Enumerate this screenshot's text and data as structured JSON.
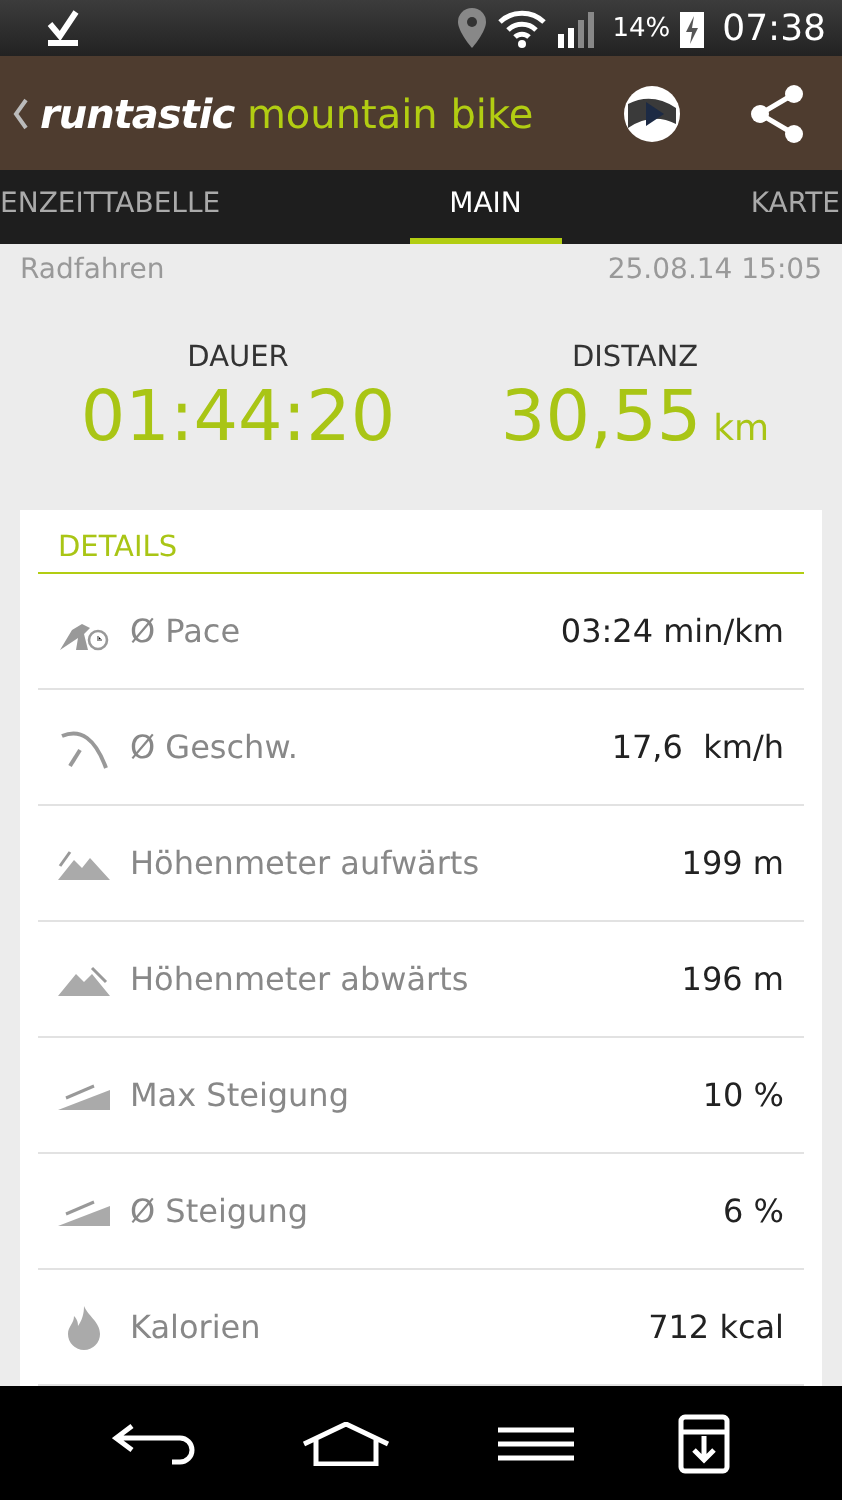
{
  "status_bar": {
    "battery": "14%",
    "time": "07:38"
  },
  "app_bar": {
    "brand": "runtastic",
    "product": "mountain bike"
  },
  "tabs": [
    {
      "label": "ENZEITTABELLE",
      "selected": false
    },
    {
      "label": "MAIN",
      "selected": true
    },
    {
      "label": "KARTE",
      "selected": false
    }
  ],
  "activity": {
    "type": "Radfahren",
    "date": "25.08.14 15:05"
  },
  "summary": [
    {
      "label": "DAUER",
      "value": "01:44:20"
    },
    {
      "label": "DISTANZ",
      "value": "30,55",
      "unit": "km"
    }
  ],
  "details": {
    "title": "DETAILS",
    "rows": [
      {
        "kind": "pace",
        "label": "Ø Pace",
        "value": "03:24 min/km"
      },
      {
        "kind": "speed",
        "label": "Ø Geschw.",
        "value": "17,6  km/h"
      },
      {
        "kind": "ascent",
        "label": "Höhenmeter aufwärts",
        "value": "199 m"
      },
      {
        "kind": "descent",
        "label": "Höhenmeter abwärts",
        "value": "196 m"
      },
      {
        "kind": "grade",
        "label": "Max Steigung",
        "value": "10 %"
      },
      {
        "kind": "grade",
        "label": "Ø Steigung",
        "value": "6 %"
      },
      {
        "kind": "calories",
        "label": "Kalorien",
        "value": "712 kcal"
      }
    ]
  }
}
